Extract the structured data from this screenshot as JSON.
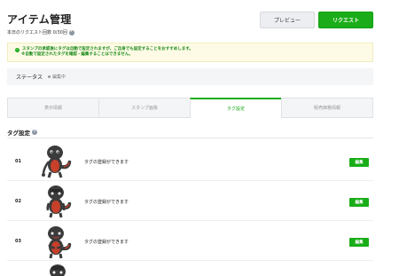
{
  "header": {
    "title": "アイテム管理",
    "request_count": "本日のリクエスト回数 0/30回",
    "help_glyph": "?"
  },
  "buttons": {
    "preview": "プレビュー",
    "request": "リクエスト"
  },
  "notice": {
    "icon": "check-circle-icon",
    "line1": "スタンプの承認後にタグは自動で設定されますが、ご自身でも設定することをおすすめします。",
    "line2": "※自動で設定されたタグを確認・編集することはできません。"
  },
  "status": {
    "label": "ステータス",
    "value": "編集中"
  },
  "tabs": [
    {
      "label": "表示情報",
      "active": false
    },
    {
      "label": "スタンプ画像",
      "active": false
    },
    {
      "label": "タグ設定",
      "active": true
    },
    {
      "label": "販売価格情報",
      "active": false
    }
  ],
  "section": {
    "title": "タグ設定"
  },
  "rows": [
    {
      "num": "01",
      "text": "タグの登録ができます",
      "edit": "編集"
    },
    {
      "num": "02",
      "text": "タグの登録ができます",
      "edit": "編集"
    },
    {
      "num": "03",
      "text": "タグの登録ができます",
      "edit": "編集"
    }
  ],
  "colors": {
    "brand_green": "#1aad19",
    "notice_bg": "#fdfbe5",
    "character_dark": "#3b3b3b",
    "character_red": "#c8402a"
  }
}
